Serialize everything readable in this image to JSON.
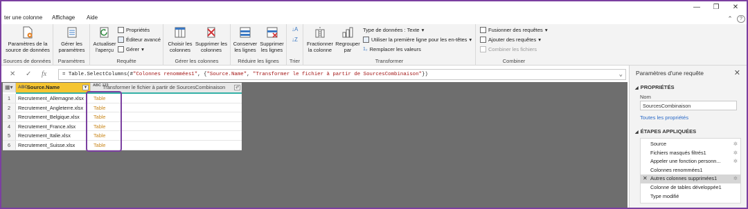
{
  "menubar": {
    "tabs": [
      "ter une colonne",
      "Affichage",
      "Aide"
    ]
  },
  "window_controls": {
    "minimize": "—",
    "restore": "❐",
    "close": "✕",
    "collapse_ribbon": "⌃",
    "help": "?"
  },
  "ribbon": {
    "groups": {
      "sources": {
        "label": "Sources de données",
        "btn": "Paramètres de la source de données"
      },
      "params": {
        "label": "Paramètres",
        "btn": "Gérer les paramètres"
      },
      "query": {
        "label": "Requête",
        "refresh": "Actualiser l'aperçu",
        "props": "Propriétés",
        "adv_editor": "Éditeur avancé",
        "manage": "Gérer"
      },
      "manage_cols": {
        "label": "Gérer les colonnes",
        "choose": "Choisir les colonnes",
        "remove": "Supprimer les colonnes"
      },
      "reduce_rows": {
        "label": "Réduire les lignes",
        "keep": "Conserver les lignes",
        "remove": "Supprimer les lignes"
      },
      "sort": {
        "label": "Trier"
      },
      "transform": {
        "label": "Transformer",
        "split": "Fractionner la colonne",
        "group": "Regrouper par",
        "data_type": "Type de données : Texte",
        "first_row": "Utiliser la première ligne pour les en-têtes",
        "replace": "Remplacer les valeurs"
      },
      "combine": {
        "label": "Combiner",
        "merge": "Fusionner des requêtes",
        "append": "Ajouter des requêtes",
        "combine_files": "Combiner les fichiers"
      }
    }
  },
  "formula": {
    "prefix": "= Table.SelectColumns(#",
    "arg1": "\"Colonnes renommées1\"",
    "mid": ", {",
    "arg2": "\"Source.Name\"",
    "sep": ", ",
    "arg3": "\"Transformer le fichier à partir de SourcesCombinaison\"",
    "suffix": "})",
    "fx": "fx"
  },
  "grid": {
    "columns": [
      {
        "type": "ABC",
        "name": "Source.Name"
      },
      {
        "type": "ABC 123",
        "name": "Transformer le fichier à partir de SourcesCombinaison"
      }
    ],
    "rows": [
      {
        "n": "1",
        "name": "Recrutement_Allemagne.xlsx",
        "val": "Table"
      },
      {
        "n": "2",
        "name": "Recrutement_Angleterre.xlsx",
        "val": "Table"
      },
      {
        "n": "3",
        "name": "Recrutement_Belgique.xlsx",
        "val": "Table"
      },
      {
        "n": "4",
        "name": "Recrutement_France.xlsx",
        "val": "Table"
      },
      {
        "n": "5",
        "name": "Recrutement_Italie.xlsx",
        "val": "Table"
      },
      {
        "n": "6",
        "name": "Recrutement_Suisse.xlsx",
        "val": "Table"
      }
    ]
  },
  "pane": {
    "title": "Paramètres d'une requête",
    "properties_title": "PROPRIÉTÉS",
    "name_label": "Nom",
    "name_value": "SourcesCombinaison",
    "all_props": "Toutes les propriétés",
    "steps_title": "ÉTAPES APPLIQUÉES",
    "steps": [
      {
        "label": "Source",
        "gear": true
      },
      {
        "label": "Fichiers masqués filtrés1",
        "gear": true
      },
      {
        "label": "Appeler une fonction personn...",
        "gear": true
      },
      {
        "label": "Colonnes renommées1",
        "gear": false
      },
      {
        "label": "Autres colonnes supprimées1",
        "gear": true,
        "selected": true
      },
      {
        "label": "Colonne de tables développée1",
        "gear": false
      },
      {
        "label": "Type modifié",
        "gear": false
      }
    ]
  },
  "colors": {
    "accent_frame": "#7b3fa0",
    "header_selected": "#f5c531",
    "table_value": "#c9871c",
    "link": "#2b6ac7"
  }
}
